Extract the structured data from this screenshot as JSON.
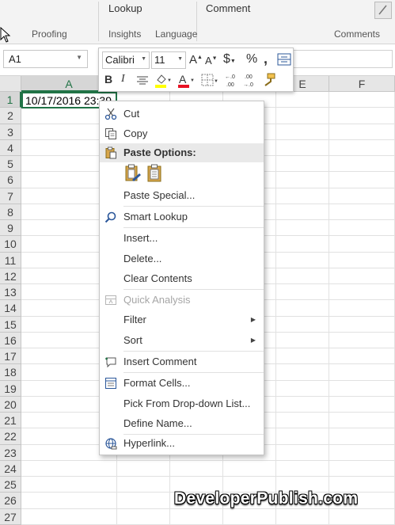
{
  "ribbon": {
    "top_labels": [
      "Lookup",
      "Comment"
    ],
    "groups": [
      "Proofing",
      "Insights",
      "Language",
      "Comments"
    ]
  },
  "name_box": {
    "value": "A1"
  },
  "grid": {
    "columns": [
      "A",
      "B",
      "C",
      "D",
      "E",
      "F"
    ],
    "selected_column": "A",
    "rows": [
      "1",
      "2",
      "3",
      "4",
      "5",
      "6",
      "7",
      "8",
      "9",
      "10",
      "11",
      "12",
      "13",
      "14",
      "15",
      "16",
      "17",
      "18",
      "19",
      "20",
      "21",
      "22",
      "23",
      "24",
      "25",
      "26",
      "27"
    ],
    "selected_row": "1",
    "active_cell_value": "10/17/2016 23:39"
  },
  "mini_toolbar": {
    "font_name": "Calibri",
    "font_size": "11",
    "accent_highlight": "#ffff00",
    "accent_font_color": "#e81123"
  },
  "context_menu": {
    "items": {
      "cut": "Cut",
      "copy": "Copy",
      "paste_options": "Paste Options:",
      "paste_special": "Paste Special...",
      "smart_lookup": "Smart Lookup",
      "insert": "Insert...",
      "delete": "Delete...",
      "clear_contents": "Clear Contents",
      "quick_analysis": "Quick Analysis",
      "filter": "Filter",
      "sort": "Sort",
      "insert_comment": "Insert Comment",
      "format_cells": "Format Cells...",
      "pick_from_list": "Pick From Drop-down List...",
      "define_name": "Define Name...",
      "hyperlink": "Hyperlink..."
    }
  },
  "colors": {
    "excel_green": "#217346",
    "menu_header_bg": "#e9e9e9"
  },
  "watermark": "DeveloperPublish.com"
}
